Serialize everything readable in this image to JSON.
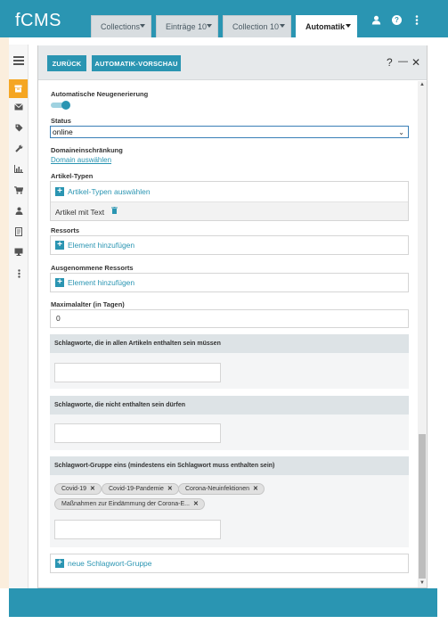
{
  "app": {
    "logo": "fCMS"
  },
  "tabs": [
    {
      "label": "Collections",
      "active": false
    },
    {
      "label": "Einträge 10",
      "active": false
    },
    {
      "label": "Collection 10",
      "active": false
    },
    {
      "label": "Automatik",
      "active": true
    }
  ],
  "topbar_icons": [
    "user-icon",
    "help-icon",
    "more-vertical-icon"
  ],
  "sidebar": {
    "icons": [
      "archive-icon",
      "envelope-icon",
      "tag-icon",
      "wrench-icon",
      "bar-chart-icon",
      "cart-icon",
      "user-icon",
      "book-icon",
      "monitor-icon",
      "more-vertical-icon"
    ],
    "active_index": 0
  },
  "toolbar": {
    "back_label": "ZURÜCK",
    "preview_label": "AUTOMATIK-VORSCHAU",
    "help_label": "?",
    "minimize_label": "—",
    "close_label": "✕"
  },
  "form": {
    "auto_regen_label": "Automatische Neugenerierung",
    "auto_regen_on": true,
    "status_label": "Status",
    "status_value": "online",
    "domain_label": "Domaineinschränkung",
    "domain_link": "Domain auswählen",
    "article_types_label": "Artikel-Typen",
    "article_types_add": "Artikel-Typen auswählen",
    "article_types_items": [
      "Artikel mit Text"
    ],
    "ressorts_label": "Ressorts",
    "ressorts_add": "Element hinzufügen",
    "excluded_ressorts_label": "Ausgenommene Ressorts",
    "excluded_ressorts_add": "Element hinzufügen",
    "max_age_label": "Maximalalter (in Tagen)",
    "max_age_value": "0",
    "keywords_must_title": "Schlagworte, die in allen Artikeln enthalten sein müssen",
    "keywords_not_title": "Schlagworte, die nicht enthalten sein dürfen",
    "keyword_group_title": "Schlagwort-Gruppe eins (mindestens ein Schlagwort muss enthalten sein)",
    "keyword_group_chips": [
      "Covid-19",
      "Covid-19-Pandemie",
      "Corona-Neuinfektionen",
      "Maßnahmen zur Eindämmung der Corona-E..."
    ],
    "new_group_label": "neue Schlagwort-Gruppe"
  },
  "colors": {
    "accent": "#2a95b2",
    "sidebar_active": "#f5a623",
    "left_bg": "#fbeedd"
  }
}
